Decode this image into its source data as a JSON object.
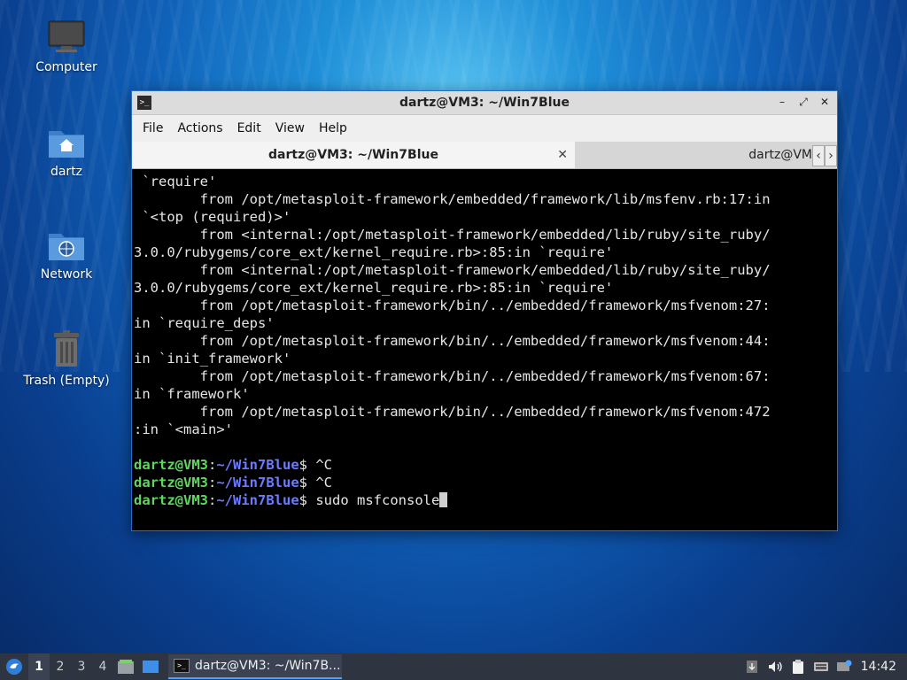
{
  "desktop": {
    "icons": [
      {
        "label": "Computer",
        "icon": "computer-icon"
      },
      {
        "label": "dartz",
        "icon": "home-folder-icon"
      },
      {
        "label": "Network",
        "icon": "network-folder-icon"
      },
      {
        "label": "Trash (Empty)",
        "icon": "trash-icon"
      }
    ]
  },
  "window": {
    "title": "dartz@VM3: ~/Win7Blue",
    "icon_glyph": ">_",
    "controls": {
      "minimize": "–",
      "maximize": "⤢",
      "close": "✕"
    },
    "menu": [
      "File",
      "Actions",
      "Edit",
      "View",
      "Help"
    ],
    "tabs": [
      {
        "label": "dartz@VM3: ~/Win7Blue",
        "close": "✕"
      },
      {
        "label": "dartz@VM"
      }
    ],
    "tab_nav": {
      "left": "‹",
      "right": "›"
    }
  },
  "terminal": {
    "lines": [
      " `require'",
      "        from /opt/metasploit-framework/embedded/framework/lib/msfenv.rb:17:in",
      " `<top (required)>'",
      "        from <internal:/opt/metasploit-framework/embedded/lib/ruby/site_ruby/",
      "3.0.0/rubygems/core_ext/kernel_require.rb>:85:in `require'",
      "        from <internal:/opt/metasploit-framework/embedded/lib/ruby/site_ruby/",
      "3.0.0/rubygems/core_ext/kernel_require.rb>:85:in `require'",
      "        from /opt/metasploit-framework/bin/../embedded/framework/msfvenom:27:",
      "in `require_deps'",
      "        from /opt/metasploit-framework/bin/../embedded/framework/msfvenom:44:",
      "in `init_framework'",
      "        from /opt/metasploit-framework/bin/../embedded/framework/msfvenom:67:",
      "in `framework'",
      "        from /opt/metasploit-framework/bin/../embedded/framework/msfvenom:472",
      ":in `<main>'",
      ""
    ],
    "prompt": {
      "user": "dartz@VM3",
      "sep": ":",
      "path": "~/Win7Blue",
      "symbol": "$ "
    },
    "commands": [
      "^C",
      "^C",
      "sudo msfconsole"
    ]
  },
  "taskbar": {
    "workspaces": [
      "1",
      "2",
      "3",
      "4"
    ],
    "active_workspace": "1",
    "task_label": "dartz@VM3: ~/Win7B...",
    "clock": "14:42"
  }
}
